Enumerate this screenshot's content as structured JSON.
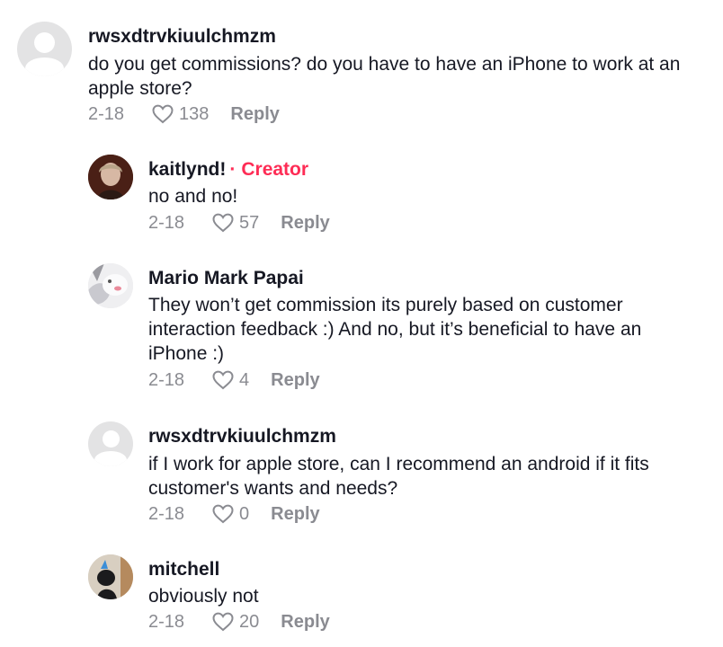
{
  "comments": [
    {
      "username": "rwsxdtrvkiuulchmzm",
      "text": "do you get commissions? do you have to have an iPhone to work at an apple store?",
      "date": "2-18",
      "likes": "138",
      "reply": "Reply",
      "avatar": "default-avatar-icon"
    },
    {
      "username": "kaitlynd!",
      "creator_label": "Creator",
      "separator": "·",
      "text": "no and no!",
      "date": "2-18",
      "likes": "57",
      "reply": "Reply",
      "avatar": "profile-photo"
    },
    {
      "username": "Mario Mark Papai",
      "text": "They won’t get commission its purely based on customer interaction feedback :) And no, but it’s beneficial to have an iPhone :)",
      "date": "2-18",
      "likes": "4",
      "reply": "Reply",
      "avatar": "cat-photo"
    },
    {
      "username": "rwsxdtrvkiuulchmzm",
      "text": "if I work for apple store, can I recommend an android if it fits customer's wants and needs?",
      "date": "2-18",
      "likes": "0",
      "reply": "Reply",
      "avatar": "default-avatar-icon"
    },
    {
      "username": "mitchell",
      "text": "obviously not",
      "date": "2-18",
      "likes": "20",
      "reply": "Reply",
      "avatar": "dog-photo"
    }
  ],
  "colors": {
    "creator_accent": "#fe2c55",
    "meta_gray": "#8a8b91",
    "text": "#161823"
  }
}
